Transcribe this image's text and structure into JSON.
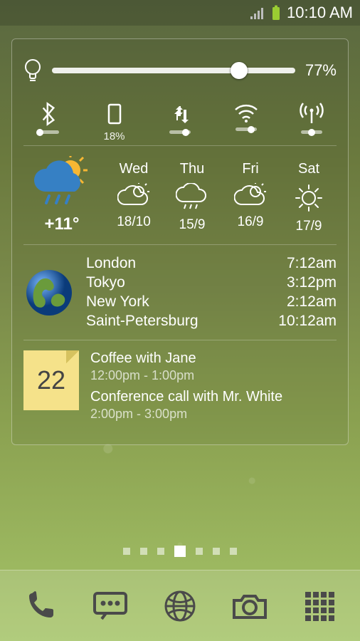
{
  "status_bar": {
    "time": "10:10 AM"
  },
  "brightness": {
    "percent": "77%",
    "value": 77
  },
  "toggles": {
    "bluetooth": {
      "label": "",
      "pos": 10
    },
    "rotation": {
      "label": "18%",
      "pos": 30
    },
    "data": {
      "label": "",
      "pos": 75
    },
    "wifi": {
      "label": "",
      "pos": 75
    },
    "hotspot": {
      "label": "",
      "pos": 50
    }
  },
  "forecast": {
    "today": {
      "temp": "+11°"
    },
    "days": [
      {
        "name": "Wed",
        "icon": "partly-cloudy",
        "temps": "18/10"
      },
      {
        "name": "Thu",
        "icon": "rain",
        "temps": "15/9"
      },
      {
        "name": "Fri",
        "icon": "partly-cloudy",
        "temps": "16/9"
      },
      {
        "name": "Sat",
        "icon": "sunny",
        "temps": "17/9"
      }
    ]
  },
  "world_clock": [
    {
      "city": "London",
      "time": "7:12am"
    },
    {
      "city": "Tokyo",
      "time": "3:12pm"
    },
    {
      "city": "New York",
      "time": "2:12am"
    },
    {
      "city": "Saint-Petersburg",
      "time": "10:12am"
    }
  ],
  "calendar": {
    "date": "22",
    "events": [
      {
        "title": "Coffee with Jane",
        "time": "12:00pm - 1:00pm"
      },
      {
        "title": "Conference call with Mr. White",
        "time": "2:00pm - 3:00pm"
      }
    ]
  },
  "pager": {
    "count": 7,
    "active": 3
  }
}
